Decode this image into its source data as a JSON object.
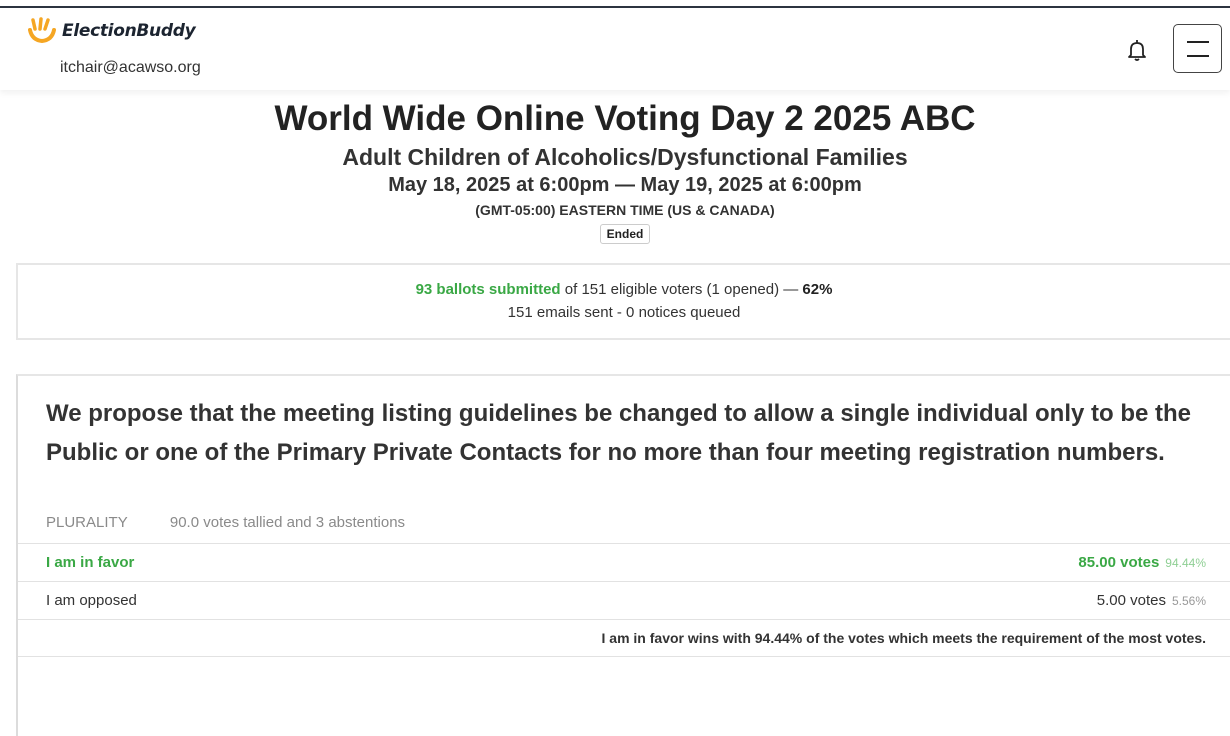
{
  "header": {
    "brand": "ElectionBuddy",
    "user_email": "itchair@acawso.org"
  },
  "election": {
    "title": "World Wide Online Voting Day 2 2025 ABC",
    "organization": "Adult Children of Alcoholics/Dysfunctional Families",
    "dates": "May 18, 2025 at 6:00pm — May 19, 2025 at 6:00pm",
    "timezone": "(GMT-05:00) EASTERN TIME (US & CANADA)",
    "status": "Ended"
  },
  "stats": {
    "ballots_submitted": "93 ballots submitted",
    "eligible_text": " of 151 eligible voters (1 opened) — ",
    "turnout": "62%",
    "emails": "151 emails sent - 0 notices queued"
  },
  "question": {
    "text": "We propose that the meeting listing guidelines be changed to allow a single individual only to be the Public or one of the Primary Private Contacts for no more than four meeting registration numbers.",
    "method": "PLURALITY",
    "tally": "90.0 votes tallied and 3 abstentions",
    "options": [
      {
        "label": "I am in favor",
        "votes": "85.00 votes",
        "percent": "94.44%",
        "winner": true
      },
      {
        "label": "I am opposed",
        "votes": "5.00 votes",
        "percent": "5.56%",
        "winner": false
      }
    ],
    "summary": "I am in favor wins with 94.44% of the votes which meets the requirement of the most votes."
  },
  "colors": {
    "winner_green": "#3aa845",
    "logo_orange": "#f5a623"
  }
}
